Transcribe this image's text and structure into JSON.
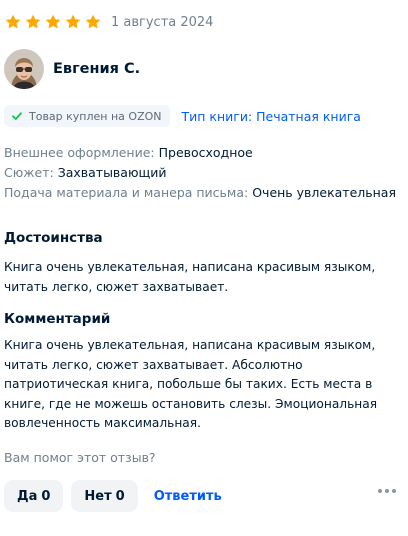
{
  "review": {
    "rating": 5,
    "rating_max": 5,
    "date": "1 августа 2024",
    "author": {
      "name": "Евгения С."
    },
    "purchase_badge": "Товар куплен на OZON",
    "book_type": "Тип книги: Печатная книга",
    "attributes": [
      {
        "key": "Внешнее оформление:",
        "value": "Превосходное"
      },
      {
        "key": "Сюжет:",
        "value": "Захватывающий"
      },
      {
        "key": "Подача материала и манера письма:",
        "value": "Очень увлекательная"
      }
    ],
    "pros": {
      "title": "Достоинства",
      "text": "Книга очень увлекательная, написана красивым языком, читать легко, сюжет захватывает."
    },
    "comment": {
      "title": "Комментарий",
      "text": "Книга очень увлекательная, написана красивым языком, читать легко, сюжет захватывает. Абсолютно патриотическая книга, побольше бы таких. Есть места в книге, где не можешь остановить слезы. Эмоциональная вовлеченность максимальная."
    },
    "helpful_question": "Вам помог этот отзыв?",
    "actions": {
      "yes_label": "Да",
      "yes_count": "0",
      "no_label": "Нет",
      "no_count": "0",
      "reply_label": "Ответить",
      "more_icon": "more-dots-icon"
    }
  },
  "colors": {
    "star": "#ffa800",
    "link": "#005bff",
    "text": "#001a34",
    "muted": "#707f8d",
    "badge_check": "#10c44c",
    "button_bg": "#f2f3f5"
  }
}
